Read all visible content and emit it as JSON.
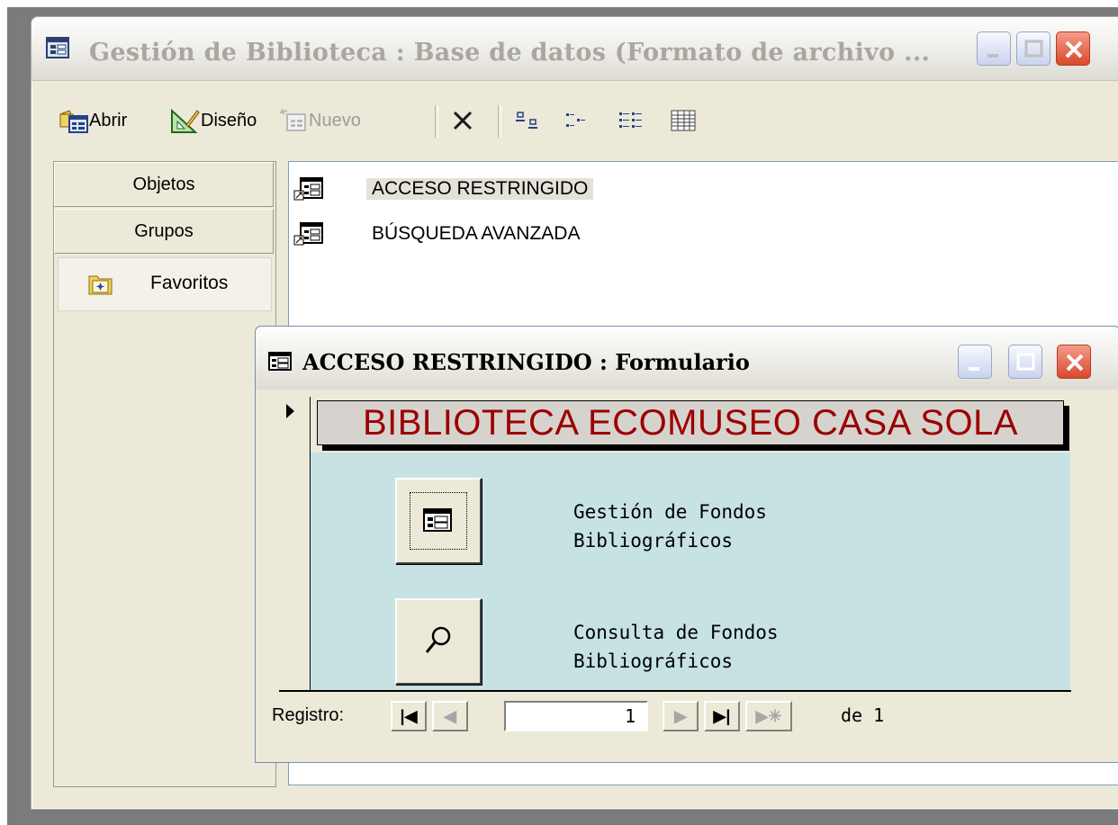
{
  "db_window": {
    "title": "Gestión de Biblioteca : Base de datos (Formato de archivo ...",
    "toolbar": {
      "open_label": "Abrir",
      "design_label": "Diseño",
      "new_label": "Nuevo"
    },
    "objects_bar": {
      "objects_label": "Objetos",
      "groups_label": "Grupos",
      "favorites_label": "Favoritos"
    },
    "forms_list": [
      {
        "label": "ACCESO RESTRINGIDO",
        "selected": true
      },
      {
        "label": "BÚSQUEDA AVANZADA",
        "selected": false
      }
    ]
  },
  "form_window": {
    "title": "ACCESO RESTRINGIDO : Formulario",
    "heading": "BIBLIOTECA ECOMUSEO CASA SOLA",
    "heading_color": "#9c0000",
    "detail_background": "#c7e2e2",
    "commands": [
      {
        "icon": "form-icon",
        "line1": "Gestión de Fondos",
        "line2": "Bibliográficos"
      },
      {
        "icon": "magnifier-icon",
        "line1": "Consulta de Fondos",
        "line2": "Bibliográficos"
      }
    ],
    "navigation": {
      "label": "Registro:",
      "current": "1",
      "of_label": "de 1"
    }
  }
}
